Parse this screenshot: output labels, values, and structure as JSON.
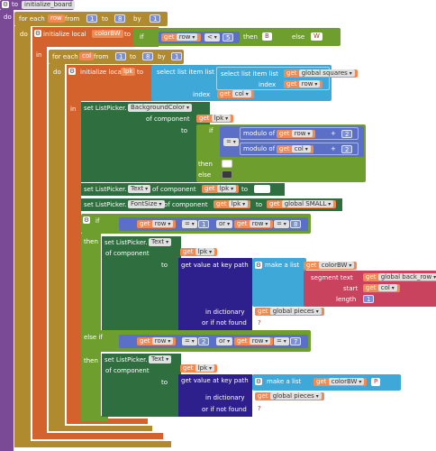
{
  "procedure": {
    "kw": "to",
    "name": "initialize_board",
    "do": "do"
  },
  "foreach_row": {
    "kw": "for each",
    "var": "row",
    "from": "from",
    "from_val": "1",
    "to": "to",
    "to_val": "8",
    "by": "by",
    "by_val": "1",
    "do": "do"
  },
  "init_colorBW": {
    "kw": "initialize local",
    "var": "colorBW",
    "to": "to",
    "if": "if",
    "get": "get",
    "cond_var": "row",
    "op": "<",
    "num": "5",
    "then": "then",
    "then_val": "B",
    "else": "else",
    "else_val": "W",
    "in": "in"
  },
  "foreach_col": {
    "kw": "for each",
    "var": "col",
    "from": "from",
    "from_val": "1",
    "to": "to",
    "to_val": "8",
    "by": "by",
    "by_val": "1",
    "do": "do"
  },
  "init_lpk": {
    "kw": "initialize local",
    "var": "lpk",
    "to": "to",
    "sel_outer": "select list item  list",
    "sel_inner": "select list item  list",
    "get": "get",
    "list_var": "global squares",
    "index": "index",
    "index_var_inner": "row",
    "index_var_outer": "col",
    "in": "in"
  },
  "set_bg": {
    "kw": "set ListPicker.",
    "prop": "BackgroundColor",
    "of": "of component",
    "get": "get",
    "comp": "lpk",
    "to": "to",
    "if": "if",
    "eq": "=",
    "mod": "modulo of",
    "row": "row",
    "col": "col",
    "plus": "+",
    "two": "2",
    "then": "then",
    "else": "else"
  },
  "set_text": {
    "kw": "set ListPicker.",
    "prop": "Text",
    "of": "of component",
    "get": "get",
    "comp": "lpk",
    "to": "to",
    "val": " "
  },
  "set_fontsize": {
    "kw": "set ListPicker.",
    "prop": "FontSize",
    "of": "of component",
    "get": "get",
    "comp": "lpk",
    "to": "to",
    "val": "global SMALL"
  },
  "if1": {
    "if": "if",
    "get": "get",
    "row": "row",
    "eq": "=",
    "n1": "1",
    "or": "or",
    "n2": "8",
    "then": "then"
  },
  "set_text2": {
    "kw": "set ListPicker.",
    "prop": "Text",
    "of": "of component",
    "get": "get",
    "comp": "lpk",
    "to": "to",
    "gvk": "get value at key path",
    "make": "make a list",
    "colorBW": "colorBW",
    "segment": "segment  text",
    "back_row": "global back_row",
    "start": "start",
    "col": "col",
    "length": "length",
    "len_val": "1",
    "in_dict": "in dictionary",
    "pieces": "global pieces",
    "notfound": "or if not found",
    "nf_val": "?"
  },
  "elseif": {
    "kw": "else if",
    "get": "get",
    "row": "row",
    "eq": "=",
    "n1": "2",
    "or": "or",
    "n2": "7",
    "then": "then"
  },
  "set_text3": {
    "kw": "set ListPicker.",
    "prop": "Text",
    "of": "of component",
    "get": "get",
    "comp": "lpk",
    "to": "to",
    "gvk": "get value at key path",
    "make": "make a list",
    "colorBW": "colorBW",
    "p": "P",
    "in_dict": "in dictionary",
    "pieces": "global pieces",
    "notfound": "or if not found",
    "nf_val": "?"
  }
}
